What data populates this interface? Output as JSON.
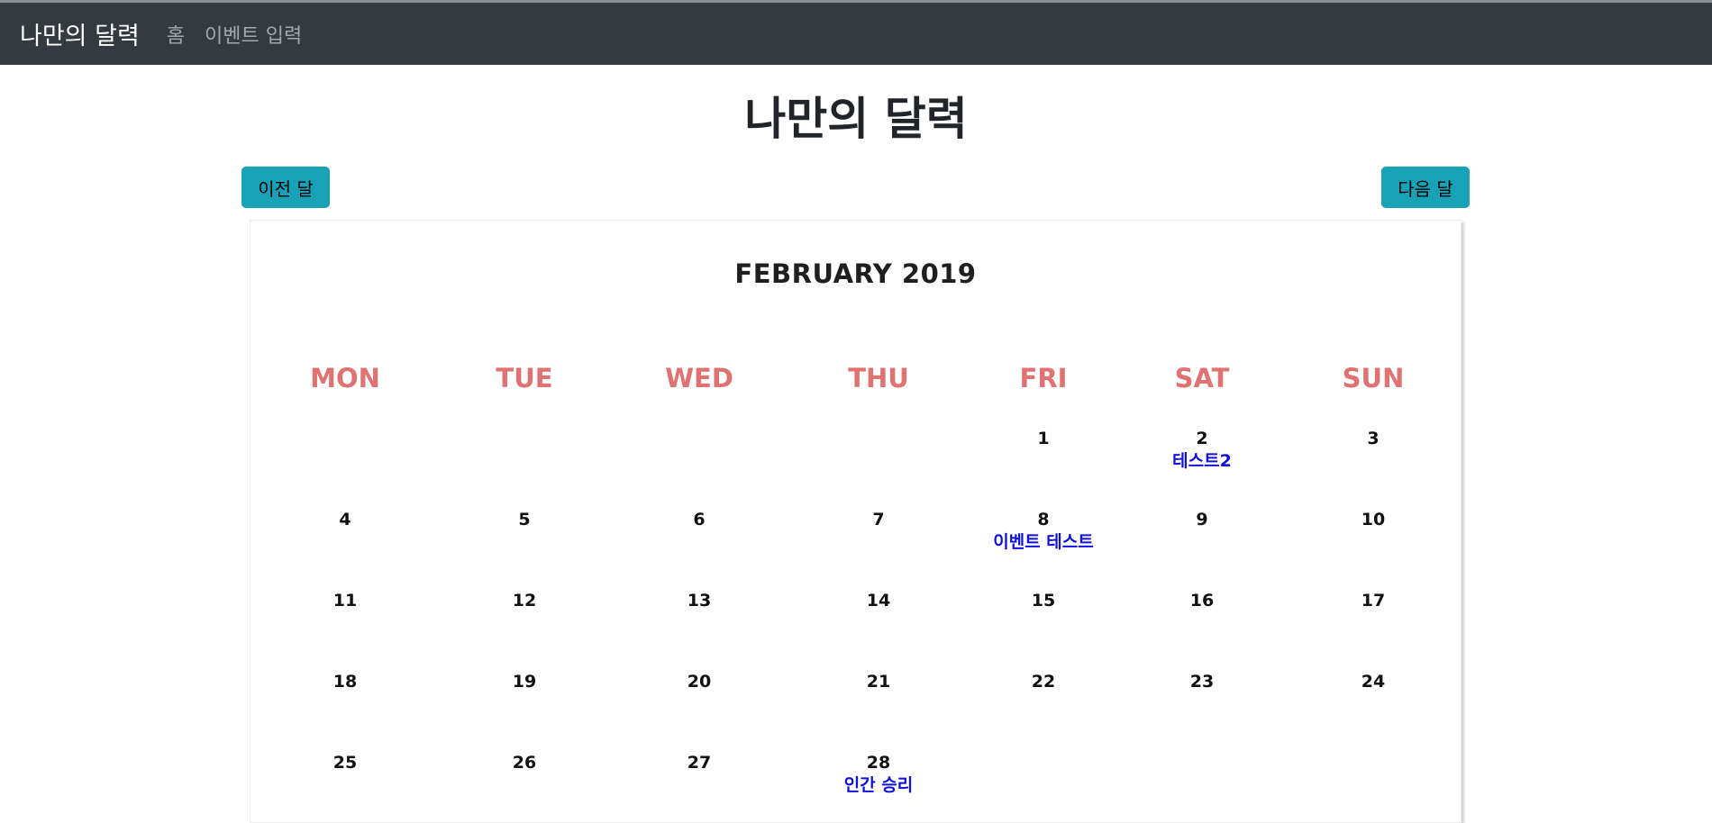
{
  "navbar": {
    "brand": "나만의 달력",
    "links": [
      "홈",
      "이벤트 입력"
    ]
  },
  "page_title": "나만의 달력",
  "buttons": {
    "prev": "이전 달",
    "next": "다음 달"
  },
  "calendar": {
    "month_title": "FEBRUARY 2019",
    "weekdays": [
      "MON",
      "TUE",
      "WED",
      "THU",
      "FRI",
      "SAT",
      "SUN"
    ],
    "weeks": [
      [
        {
          "day": "",
          "events": []
        },
        {
          "day": "",
          "events": []
        },
        {
          "day": "",
          "events": []
        },
        {
          "day": "",
          "events": []
        },
        {
          "day": "1",
          "events": []
        },
        {
          "day": "2",
          "events": [
            "테스트2"
          ]
        },
        {
          "day": "3",
          "events": []
        }
      ],
      [
        {
          "day": "4",
          "events": []
        },
        {
          "day": "5",
          "events": []
        },
        {
          "day": "6",
          "events": []
        },
        {
          "day": "7",
          "events": []
        },
        {
          "day": "8",
          "events": [
            "이벤트 테스트"
          ]
        },
        {
          "day": "9",
          "events": []
        },
        {
          "day": "10",
          "events": []
        }
      ],
      [
        {
          "day": "11",
          "events": []
        },
        {
          "day": "12",
          "events": []
        },
        {
          "day": "13",
          "events": []
        },
        {
          "day": "14",
          "events": []
        },
        {
          "day": "15",
          "events": []
        },
        {
          "day": "16",
          "events": []
        },
        {
          "day": "17",
          "events": []
        }
      ],
      [
        {
          "day": "18",
          "events": []
        },
        {
          "day": "19",
          "events": []
        },
        {
          "day": "20",
          "events": []
        },
        {
          "day": "21",
          "events": []
        },
        {
          "day": "22",
          "events": []
        },
        {
          "day": "23",
          "events": []
        },
        {
          "day": "24",
          "events": []
        }
      ],
      [
        {
          "day": "25",
          "events": []
        },
        {
          "day": "26",
          "events": []
        },
        {
          "day": "27",
          "events": []
        },
        {
          "day": "28",
          "events": [
            "인간 승리"
          ]
        },
        {
          "day": "",
          "events": []
        },
        {
          "day": "",
          "events": []
        },
        {
          "day": "",
          "events": []
        }
      ]
    ]
  },
  "colors": {
    "navbar_bg": "#343a40",
    "button_bg": "#17a2b8",
    "weekday_text": "#e07272",
    "event_text": "#1010e0"
  }
}
